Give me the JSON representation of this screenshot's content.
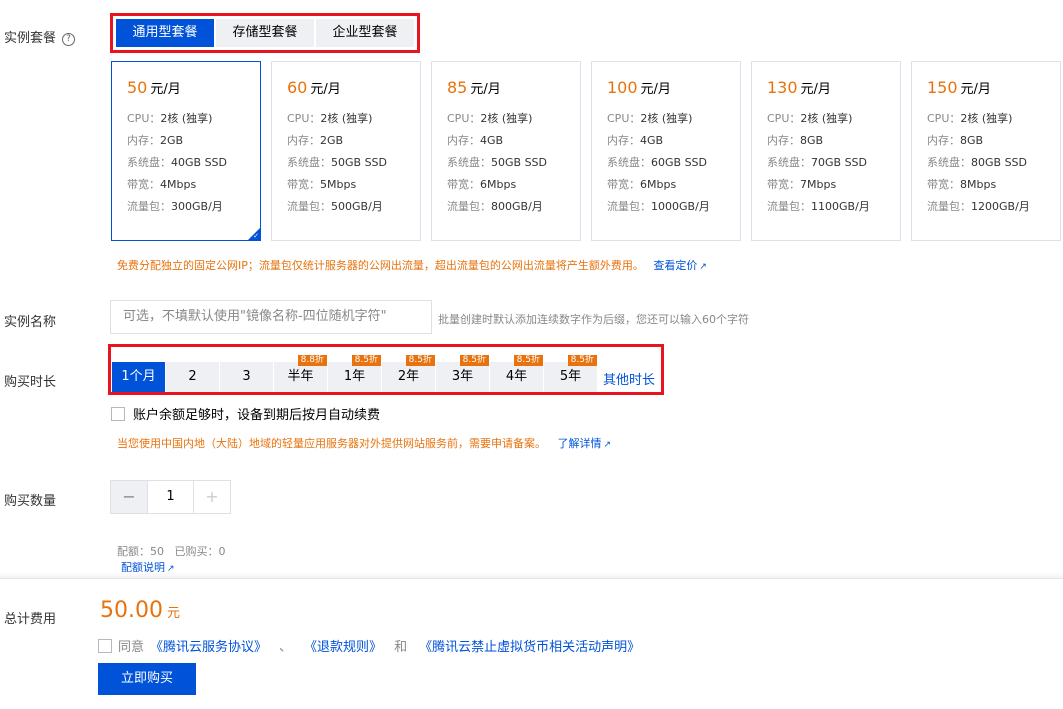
{
  "labels": {
    "package": "实例套餐",
    "name": "实例名称",
    "duration": "购买时长",
    "quantity": "购买数量",
    "total": "总计费用"
  },
  "help_icon_text": "?",
  "package_tabs": [
    {
      "label": "通用型套餐",
      "active": true
    },
    {
      "label": "存储型套餐",
      "active": false
    },
    {
      "label": "企业型套餐",
      "active": false
    }
  ],
  "spec_keys": {
    "cpu": "CPU：",
    "mem": "内存：",
    "disk": "系统盘：",
    "bw": "带宽：",
    "traffic": "流量包："
  },
  "price_unit": "元/月",
  "plans": [
    {
      "price": "50",
      "cpu": "2核 (独享)",
      "mem": "2GB",
      "disk": "40GB SSD",
      "bw": "4Mbps",
      "traffic": "300GB/月",
      "selected": true
    },
    {
      "price": "60",
      "cpu": "2核 (独享)",
      "mem": "2GB",
      "disk": "50GB SSD",
      "bw": "5Mbps",
      "traffic": "500GB/月",
      "selected": false
    },
    {
      "price": "85",
      "cpu": "2核 (独享)",
      "mem": "4GB",
      "disk": "50GB SSD",
      "bw": "6Mbps",
      "traffic": "800GB/月",
      "selected": false
    },
    {
      "price": "100",
      "cpu": "2核 (独享)",
      "mem": "4GB",
      "disk": "60GB SSD",
      "bw": "6Mbps",
      "traffic": "1000GB/月",
      "selected": false
    },
    {
      "price": "130",
      "cpu": "2核 (独享)",
      "mem": "8GB",
      "disk": "70GB SSD",
      "bw": "7Mbps",
      "traffic": "1100GB/月",
      "selected": false
    },
    {
      "price": "150",
      "cpu": "2核 (独享)",
      "mem": "8GB",
      "disk": "80GB SSD",
      "bw": "8Mbps",
      "traffic": "1200GB/月",
      "selected": false
    }
  ],
  "ip_note": "免费分配独立的固定公网IP；流量包仅统计服务器的公网出流量，超出流量包的公网出流量将产生额外费用。",
  "ip_note_link": "查看定价",
  "name_placeholder": "可选，不填默认使用\"镜像名称-四位随机字符\"",
  "name_hint": "批量创建时默认添加连续数字作为后缀，您还可以输入60个字符",
  "durations": [
    {
      "label": "1个月",
      "badge": "",
      "active": true
    },
    {
      "label": "2",
      "badge": "",
      "active": false
    },
    {
      "label": "3",
      "badge": "",
      "active": false
    },
    {
      "label": "半年",
      "badge": "8.8折",
      "active": false
    },
    {
      "label": "1年",
      "badge": "8.5折",
      "active": false
    },
    {
      "label": "2年",
      "badge": "8.5折",
      "active": false
    },
    {
      "label": "3年",
      "badge": "8.5折",
      "active": false
    },
    {
      "label": "4年",
      "badge": "8.5折",
      "active": false
    },
    {
      "label": "5年",
      "badge": "8.5折",
      "active": false
    }
  ],
  "duration_other": "其他时长",
  "auto_renew_label": "账户余额足够时，设备到期后按月自动续费",
  "icp_note": "当您使用中国内地（大陆）地域的轻量应用服务器对外提供网站服务前，需要申请备案。",
  "icp_link": "了解详情",
  "quantity": {
    "minus": "−",
    "value": "1",
    "plus": "+"
  },
  "quota_text": "配额：50   已购买：0",
  "quota_link": "配额说明",
  "total_price": "50.00",
  "total_unit": "元",
  "agree": {
    "prefix": "同意",
    "link1": "《腾讯云服务协议》",
    "sep1": "、",
    "link2": "《退款规则》",
    "sep2": "和",
    "link3": "《腾讯云禁止虚拟货币相关活动声明》"
  },
  "buy_button": "立即购买",
  "colors": {
    "accent": "#0052d9",
    "price": "#e8730e",
    "highlight_border": "#e8141f"
  }
}
